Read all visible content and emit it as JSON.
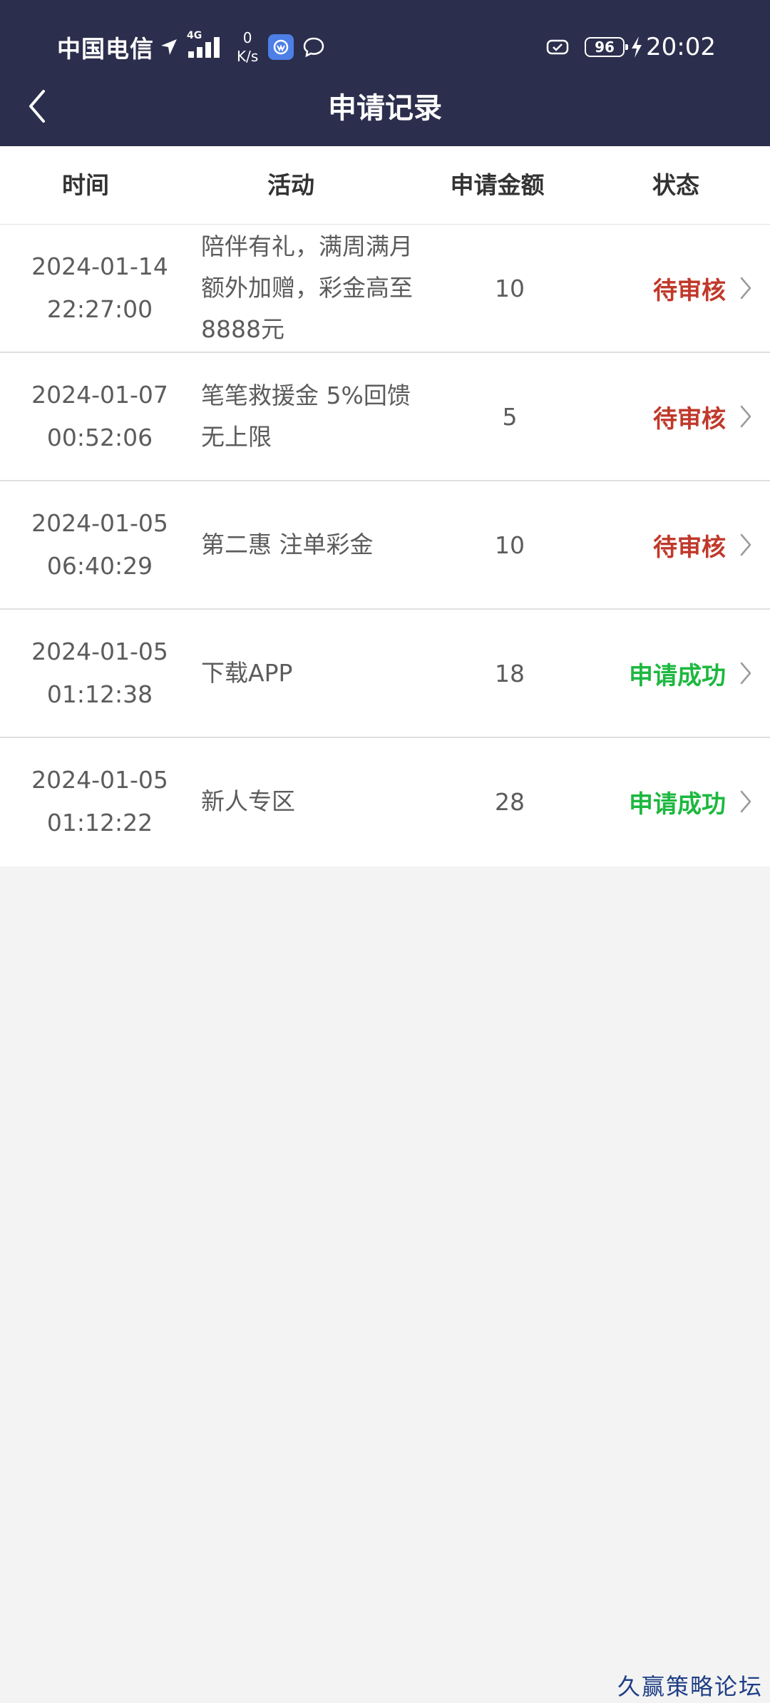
{
  "status_bar": {
    "carrier": "中国电信",
    "network_type": "4G",
    "speed_value": "0",
    "speed_unit": "K/s",
    "battery_level": "96",
    "time": "20:02"
  },
  "header": {
    "title": "申请记录"
  },
  "table": {
    "columns": [
      "时间",
      "活动",
      "申请金额",
      "状态"
    ],
    "rows": [
      {
        "date": "2024-01-14",
        "time": "22:27:00",
        "activity": "陪伴有礼，满周满月额外加赠，彩金高至8888元",
        "amount": "10",
        "status": "待审核",
        "status_color": "#c0392b"
      },
      {
        "date": "2024-01-07",
        "time": "00:52:06",
        "activity": "笔笔救援金 5%回馈无上限",
        "amount": "5",
        "status": "待审核",
        "status_color": "#c0392b"
      },
      {
        "date": "2024-01-05",
        "time": "06:40:29",
        "activity": "第二惠 注单彩金",
        "amount": "10",
        "status": "待审核",
        "status_color": "#c0392b"
      },
      {
        "date": "2024-01-05",
        "time": "01:12:38",
        "activity": "下载APP",
        "amount": "18",
        "status": "申请成功",
        "status_color": "#1db83f"
      },
      {
        "date": "2024-01-05",
        "time": "01:12:22",
        "activity": "新人专区",
        "amount": "28",
        "status": "申请成功",
        "status_color": "#1db83f"
      }
    ]
  },
  "watermark": "久赢策略论坛",
  "colors": {
    "header_bg": "#2b2e4c",
    "page_bg": "#f3f3f3",
    "pending": "#c0392b",
    "success": "#1db83f"
  }
}
